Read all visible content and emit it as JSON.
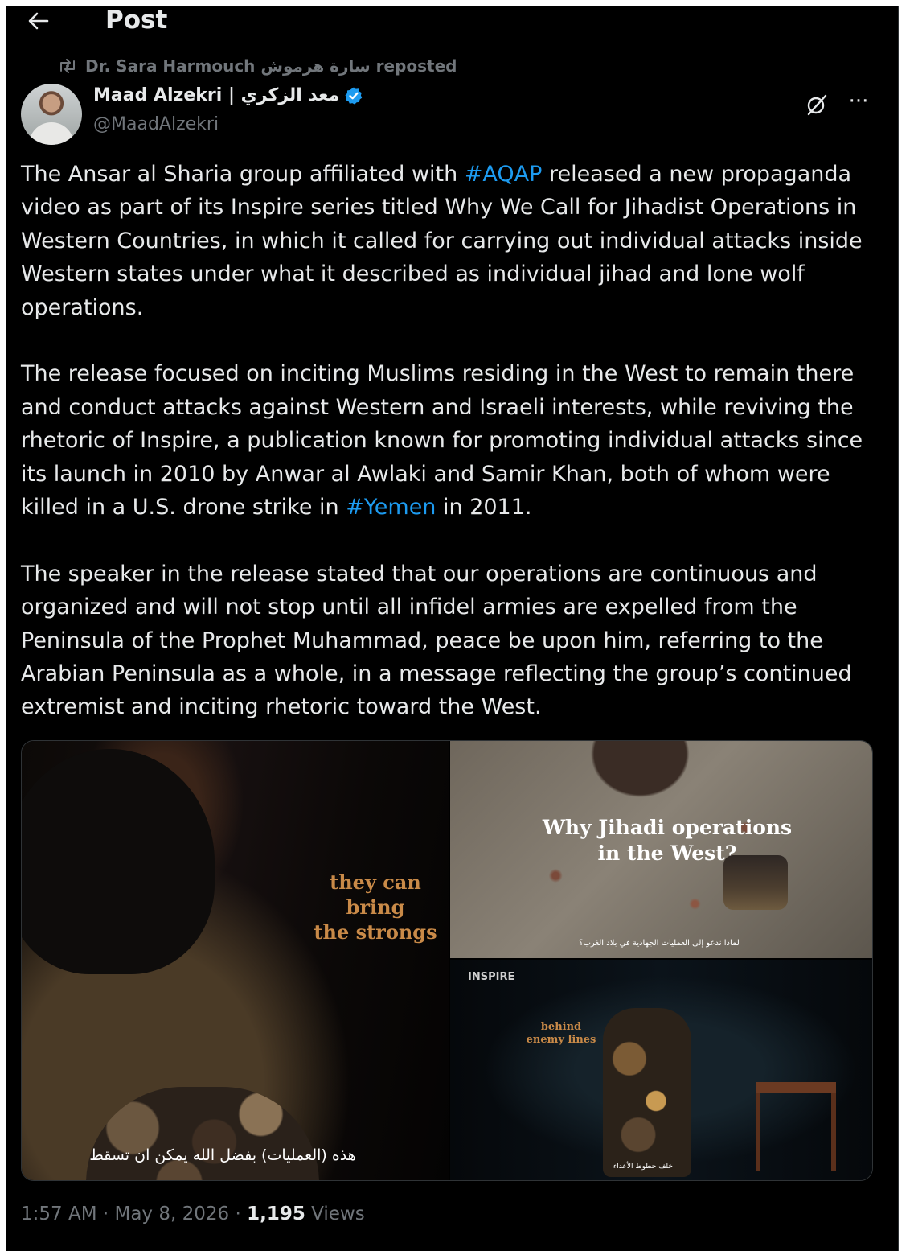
{
  "header": {
    "back_icon": "arrow-left-icon",
    "title": "Post"
  },
  "repost": {
    "icon": "repost-icon",
    "text": "Dr. Sara Harmouch سارة هرموش reposted"
  },
  "author": {
    "name": "Maad Alzekri | معد الزكري",
    "handle": "@MaadAlzekri",
    "verified_icon": "verified-badge-icon",
    "verified_color": "#1d9bf0"
  },
  "actions": {
    "grok_icon": "grok-icon",
    "more_label": "···"
  },
  "post": {
    "p1_a": "The Ansar al Sharia group affiliated with ",
    "p1_hashtag": "#AQAP",
    "p1_b": " released a new propaganda video as part of its Inspire series titled Why We Call for Jihadist Operations in Western Countries, in which it called for carrying out individual attacks inside Western states under what it described as individual jihad and lone wolf operations.",
    "p2_a": "The release focused on inciting Muslims residing in the West to remain there and conduct attacks against Western and Israeli interests, while reviving the rhetoric of Inspire, a publication known for promoting individual attacks since its launch in 2010 by Anwar al Awlaki and Samir Khan, both of whom were killed in a U.S. drone strike in ",
    "p2_hashtag": "#Yemen",
    "p2_b": " in 2011.",
    "p3": "The speaker in the release stated that  our operations are continuous and organized and will not stop until all infidel armies are expelled from the Peninsula of the Prophet Muhammad, peace be upon him, referring to the Arabian Peninsula as a whole, in a message reflecting the group’s continued extremist and inciting rhetoric toward the West."
  },
  "media": [
    {
      "overlay_l1": "they can",
      "overlay_l2": "bring",
      "overlay_l3": "the strongs",
      "subtitle": "هذه (العمليات) بفضل الله يمكن ان تسقط"
    },
    {
      "overlay_l1": "Why Jihadi operations",
      "overlay_l2": "in the West?",
      "subtitle": "لماذا ندعو إلى العمليات الجهادية في بلاد الغرب؟"
    },
    {
      "logo": "INSPIRE",
      "overlay_l1": "behind",
      "overlay_l2": "enemy lines",
      "subtitle": "خلف خطوط الأعداء"
    }
  ],
  "meta": {
    "time": "1:57 AM",
    "sep1": " · ",
    "date": "May 8, 2026",
    "sep2": " · ",
    "views_count": "1,195",
    "views_label": " Views"
  },
  "colors": {
    "background": "#000000",
    "text": "#e7e9ea",
    "muted": "#71767b",
    "link": "#1d9bf0"
  }
}
